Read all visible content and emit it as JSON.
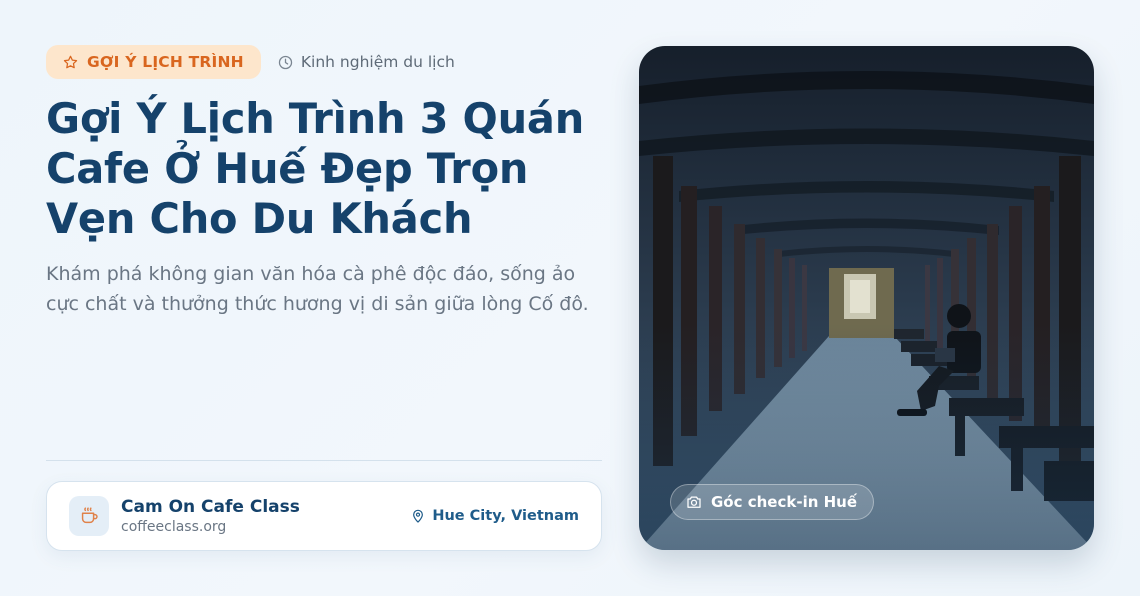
{
  "header": {
    "badge_label": "GỢI Ý LỊCH TRÌNH",
    "badge_icon": "star-icon",
    "category_label": "Kinh nghiệm du lịch",
    "category_icon": "clock-icon"
  },
  "article": {
    "title": "Gợi Ý Lịch Trình 3 Quán Cafe Ở Huế Đẹp Trọn Vẹn Cho Du Khách",
    "subtitle": "Khám phá không gian văn hóa cà phê độc đáo, sống ảo cực chất và thưởng thức hương vị di sản giữa lòng Cố đô."
  },
  "source_card": {
    "icon": "coffee-cup-icon",
    "name": "Cam On Cafe Class",
    "url": "coffeeclass.org",
    "location_icon": "map-pin-icon",
    "location": "Hue City, Vietnam"
  },
  "photo": {
    "chip_icon": "camera-icon",
    "chip_label": "Góc check-in Huế"
  },
  "colors": {
    "accent": "#d9661f",
    "badge_bg": "#fde6cc",
    "title": "#15426b",
    "body_text": "#6a7684",
    "location": "#1f5c8a"
  }
}
